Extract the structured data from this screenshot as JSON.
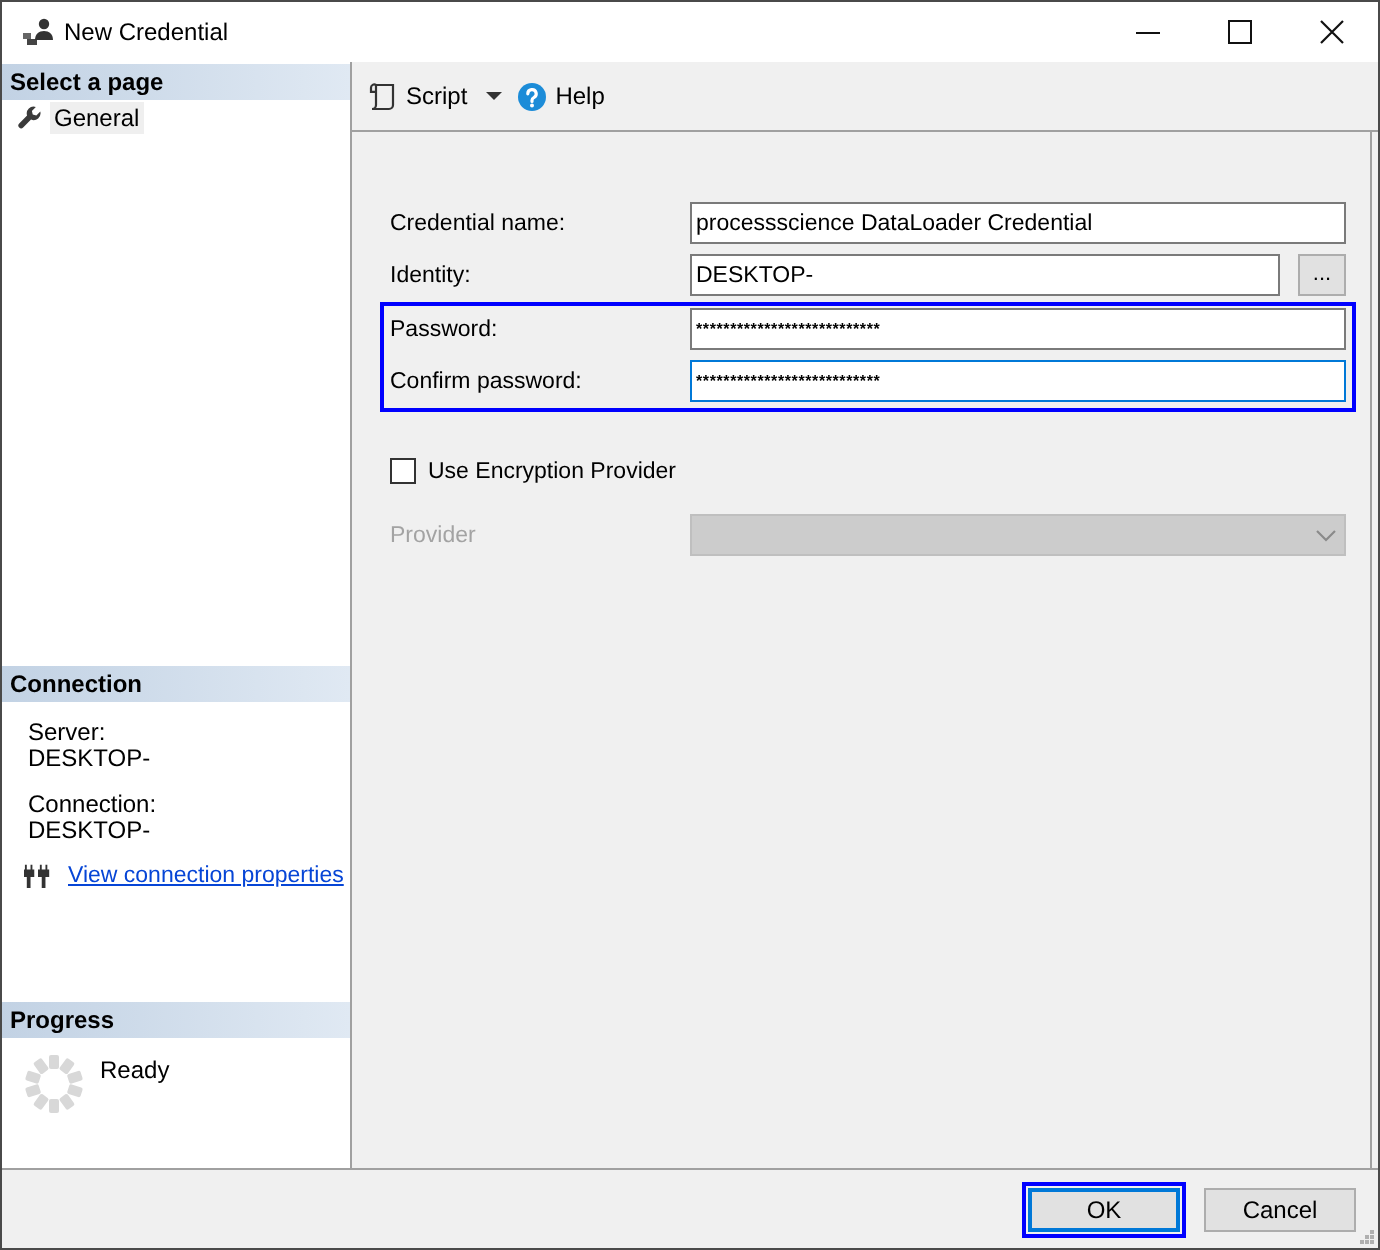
{
  "window": {
    "title": "New Credential"
  },
  "sidebar": {
    "pages_header": "Select a page",
    "pages": [
      {
        "label": "General",
        "selected": true
      }
    ],
    "connection": {
      "header": "Connection",
      "fields": [
        {
          "label": "Server:",
          "value": "DESKTOP-"
        },
        {
          "label": "Connection:",
          "value": "DESKTOP-"
        }
      ],
      "link": "View connection properties"
    },
    "progress": {
      "header": "Progress",
      "status": "Ready"
    }
  },
  "toolbar": {
    "items": [
      {
        "kind": "script",
        "label": "Script"
      },
      {
        "kind": "help",
        "label": "Help"
      }
    ]
  },
  "form": {
    "groups": [
      {
        "highlighted": false,
        "rows": [
          {
            "kind": "text",
            "label": "Credential name:",
            "value": "processscience DataLoader Credential",
            "focused": false
          },
          {
            "kind": "text_browse",
            "label": "Identity:",
            "value": "DESKTOP-",
            "button": "...",
            "focused": false
          }
        ]
      },
      {
        "highlighted": true,
        "rows": [
          {
            "kind": "password",
            "label": "Password:",
            "value": "***************************",
            "focused": false
          },
          {
            "kind": "password",
            "label": "Confirm password:",
            "value": "***************************",
            "focused": true
          }
        ]
      }
    ],
    "encryption": {
      "label": "Use Encryption Provider",
      "checked": false
    },
    "provider": {
      "label": "Provider",
      "disabled": true
    }
  },
  "buttons": [
    {
      "label": "OK",
      "default": true,
      "highlighted": true
    },
    {
      "label": "Cancel",
      "default": false,
      "highlighted": false
    }
  ]
}
